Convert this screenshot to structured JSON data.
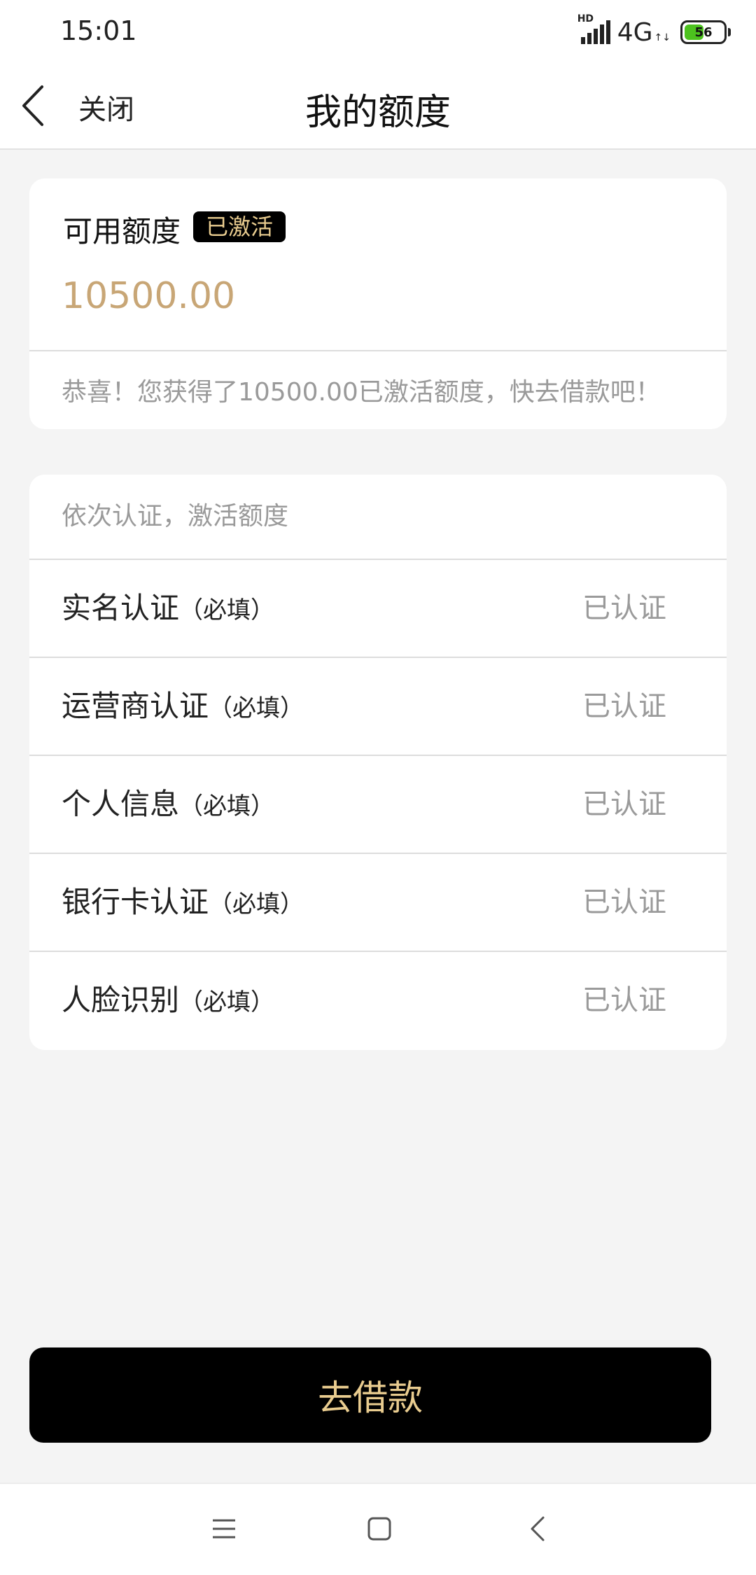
{
  "status_bar": {
    "time": "15:01",
    "hd_label": "HD",
    "network": "4G",
    "network_arrows": "↑↓",
    "battery_level": "56",
    "battery_percent": 56,
    "battery_color": "#4cc21e"
  },
  "nav": {
    "back_icon": "chevron-left-icon",
    "close_label": "关闭",
    "title": "我的额度"
  },
  "quota": {
    "label": "可用额度",
    "badge": "已激活",
    "amount": "10500.00",
    "message": "恭喜！您获得了10500.00已激活额度，快去借款吧！",
    "amount_color": "#c8a676",
    "badge_text_color": "#e9cc8f"
  },
  "verification": {
    "header": "依次认证，激活额度",
    "items": [
      {
        "name": "实名认证",
        "required": "（必填）",
        "status": "已认证"
      },
      {
        "name": "运营商认证",
        "required": "（必填）",
        "status": "已认证"
      },
      {
        "name": "个人信息",
        "required": "（必填）",
        "status": "已认证"
      },
      {
        "name": "银行卡认证",
        "required": "（必填）",
        "status": "已认证"
      },
      {
        "name": "人脸识别",
        "required": "（必填）",
        "status": "已认证"
      }
    ]
  },
  "action": {
    "loan_label": "去借款",
    "button_bg": "#000000",
    "button_text_color": "#e9cc8f"
  },
  "system_nav": {
    "menu_icon": "menu-icon",
    "home_icon": "home-square-icon",
    "back_icon": "back-chevron-icon"
  }
}
